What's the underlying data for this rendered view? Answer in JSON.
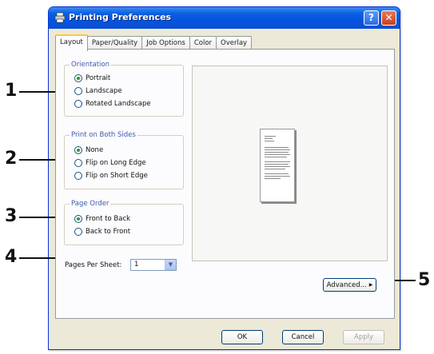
{
  "window": {
    "title": "Printing Preferences",
    "help_label": "?",
    "close_label": "✕"
  },
  "tabs": [
    {
      "label": "Layout",
      "active": true
    },
    {
      "label": "Paper/Quality",
      "active": false
    },
    {
      "label": "Job Options",
      "active": false
    },
    {
      "label": "Color",
      "active": false
    },
    {
      "label": "Overlay",
      "active": false
    }
  ],
  "orientation": {
    "label": "Orientation",
    "options": [
      "Portrait",
      "Landscape",
      "Rotated Landscape"
    ],
    "selected": "Portrait"
  },
  "print_both_sides": {
    "label": "Print on Both Sides",
    "options": [
      "None",
      "Flip on Long Edge",
      "Flip on Short Edge"
    ],
    "selected": "None"
  },
  "page_order": {
    "label": "Page Order",
    "options": [
      "Front to Back",
      "Back to Front"
    ],
    "selected": "Front to Back"
  },
  "pages_per_sheet": {
    "label": "Pages Per Sheet:",
    "value": "1"
  },
  "advanced_label": "Advanced...",
  "buttons": {
    "ok": "OK",
    "cancel": "Cancel",
    "apply": "Apply"
  },
  "callouts": [
    "1",
    "2",
    "3",
    "4",
    "5"
  ],
  "colors": {
    "titlebar": "#0554e0",
    "dialog_bg": "#ece9d8",
    "group_label": "#3f5ba9",
    "radio_dot": "#21a121"
  }
}
